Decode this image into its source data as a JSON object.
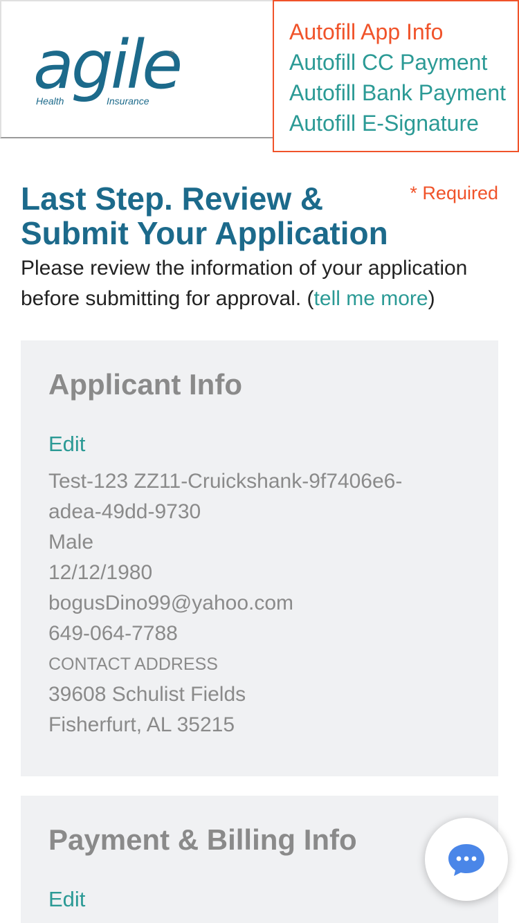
{
  "brand": {
    "logo_text": "agile",
    "logo_registered": "®",
    "logo_sub_left": "Health",
    "logo_sub_right": "Insurance",
    "color_primary": "#1c6a8b",
    "color_accent": "#2b9a95",
    "color_alert": "#f0532a"
  },
  "autofill": {
    "items": [
      {
        "label": "Autofill App Info",
        "active": true
      },
      {
        "label": "Autofill CC Payment",
        "active": false
      },
      {
        "label": "Autofill Bank Payment",
        "active": false
      },
      {
        "label": "Autofill E-Signature",
        "active": false
      }
    ]
  },
  "page": {
    "title": "Last Step. Review & Submit Your Application",
    "required_note": "* Required",
    "intro_text": "Please review the information of your application before submitting for approval. (",
    "intro_link": "tell me more",
    "intro_close": ")"
  },
  "applicant": {
    "title": "Applicant Info",
    "edit_label": "Edit",
    "name_line1": "Test-123 ZZ11-Cruickshank-9f7406e6-",
    "name_line2": "adea-49dd-9730",
    "gender": "Male",
    "dob": "12/12/1980",
    "email": "bogusDino99@yahoo.com",
    "phone": "649-064-7788",
    "address_label": "CONTACT ADDRESS",
    "address_line1": "39608 Schulist Fields",
    "address_line2": "Fisherfurt, AL 35215"
  },
  "payment": {
    "title": "Payment & Billing Info",
    "edit_label": "Edit"
  },
  "chat": {
    "icon": "chat-bubble-icon"
  }
}
